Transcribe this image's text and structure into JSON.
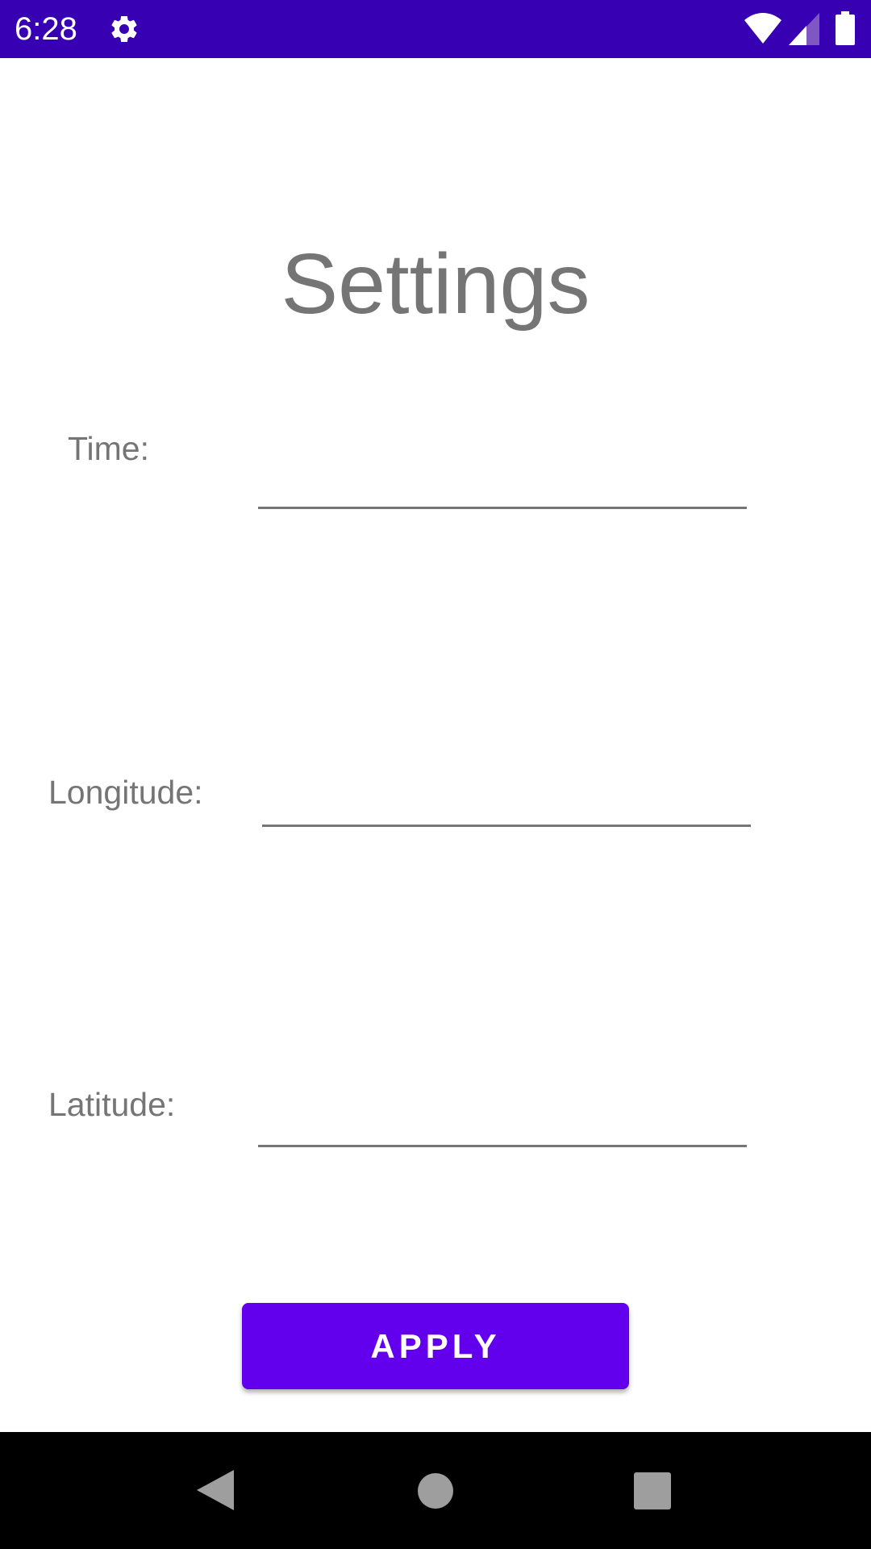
{
  "status_bar": {
    "time": "6:28",
    "icons": [
      "gear-icon",
      "wifi-icon",
      "signal-icon",
      "battery-icon"
    ],
    "background_color": "#3700B3"
  },
  "page": {
    "title": "Settings"
  },
  "form": {
    "time": {
      "label": "Time:",
      "value": ""
    },
    "longitude": {
      "label": "Longitude:",
      "value": ""
    },
    "latitude": {
      "label": "Latitude:",
      "value": ""
    }
  },
  "apply_button": {
    "label": "APPLY",
    "color": "#6200EE"
  },
  "nav_bar": {
    "icons": [
      "back-icon",
      "home-icon",
      "recents-icon"
    ]
  }
}
